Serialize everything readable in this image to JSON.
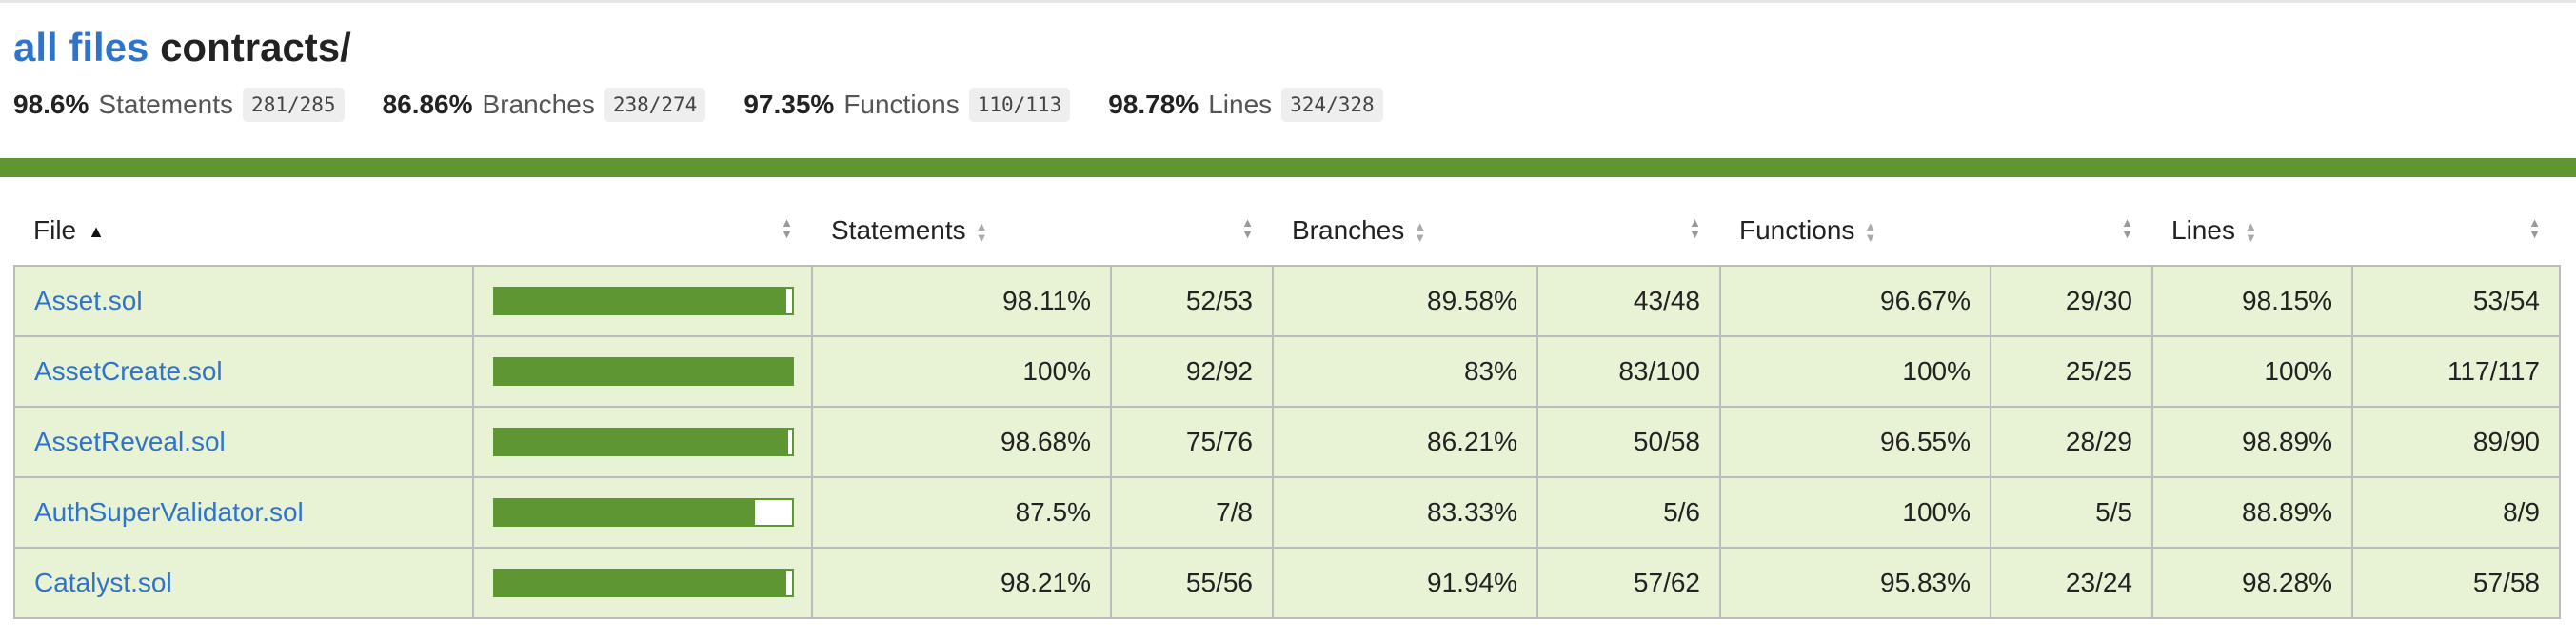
{
  "header": {
    "root_link": "all files",
    "path": "contracts/"
  },
  "summary": [
    {
      "pct": "98.6%",
      "label": "Statements",
      "frac": "281/285"
    },
    {
      "pct": "86.86%",
      "label": "Branches",
      "frac": "238/274"
    },
    {
      "pct": "97.35%",
      "label": "Functions",
      "frac": "110/113"
    },
    {
      "pct": "98.78%",
      "label": "Lines",
      "frac": "324/328"
    }
  ],
  "colors": {
    "link": "#2f74c8",
    "high_coverage_bar": "#5e9732",
    "high_coverage_row": "#e8f3d6"
  },
  "table": {
    "columns": {
      "file": "File",
      "statements": "Statements",
      "branches": "Branches",
      "functions": "Functions",
      "lines": "Lines"
    },
    "rows": [
      {
        "file": "Asset.sol",
        "coverage": 0.9811,
        "stmt_pct": "98.11%",
        "stmt_frac": "52/53",
        "br_pct": "89.58%",
        "br_frac": "43/48",
        "fn_pct": "96.67%",
        "fn_frac": "29/30",
        "ln_pct": "98.15%",
        "ln_frac": "53/54"
      },
      {
        "file": "AssetCreate.sol",
        "coverage": 1.0,
        "stmt_pct": "100%",
        "stmt_frac": "92/92",
        "br_pct": "83%",
        "br_frac": "83/100",
        "fn_pct": "100%",
        "fn_frac": "25/25",
        "ln_pct": "100%",
        "ln_frac": "117/117"
      },
      {
        "file": "AssetReveal.sol",
        "coverage": 0.9868,
        "stmt_pct": "98.68%",
        "stmt_frac": "75/76",
        "br_pct": "86.21%",
        "br_frac": "50/58",
        "fn_pct": "96.55%",
        "fn_frac": "28/29",
        "ln_pct": "98.89%",
        "ln_frac": "89/90"
      },
      {
        "file": "AuthSuperValidator.sol",
        "coverage": 0.875,
        "stmt_pct": "87.5%",
        "stmt_frac": "7/8",
        "br_pct": "83.33%",
        "br_frac": "5/6",
        "fn_pct": "100%",
        "fn_frac": "5/5",
        "ln_pct": "88.89%",
        "ln_frac": "8/9"
      },
      {
        "file": "Catalyst.sol",
        "coverage": 0.9821,
        "stmt_pct": "98.21%",
        "stmt_frac": "55/56",
        "br_pct": "91.94%",
        "br_frac": "57/62",
        "fn_pct": "95.83%",
        "fn_frac": "23/24",
        "ln_pct": "98.28%",
        "ln_frac": "57/58"
      }
    ]
  }
}
